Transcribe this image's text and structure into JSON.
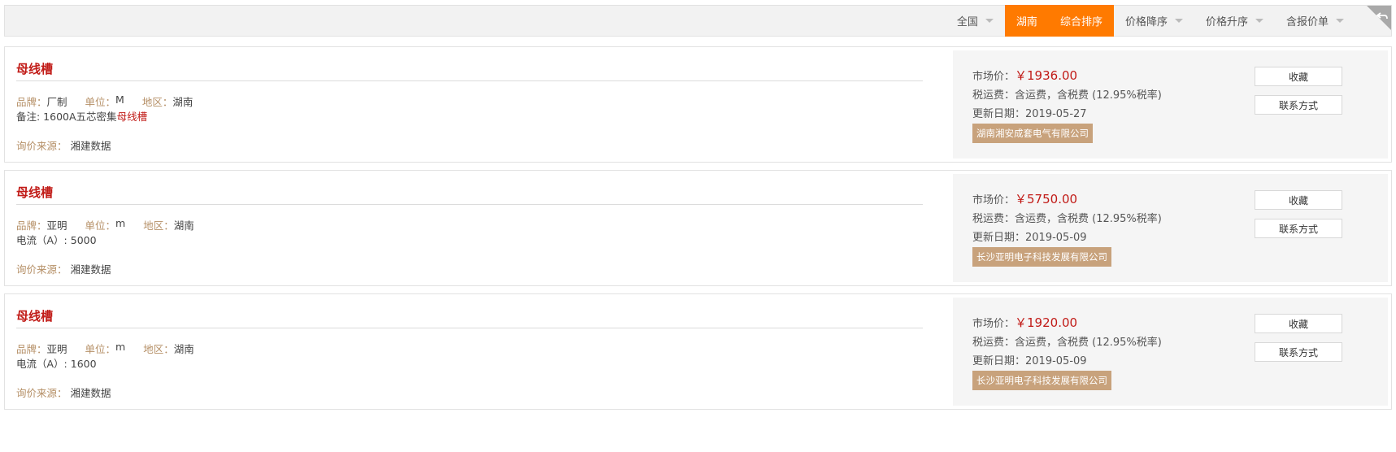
{
  "filters": {
    "items": [
      {
        "label": "全国",
        "caret": true,
        "active": false
      },
      {
        "label": "湖南",
        "caret": false,
        "active": true
      },
      {
        "label": "综合排序",
        "caret": false,
        "active": true
      },
      {
        "label": "价格降序",
        "caret": true,
        "active": false
      },
      {
        "label": "价格升序",
        "caret": true,
        "active": false
      },
      {
        "label": "含报价单",
        "caret": true,
        "active": false
      }
    ],
    "accent_color": "#ff7a00"
  },
  "labels": {
    "brand": "品牌：",
    "unit": "单位：",
    "region": "地区：",
    "source": "询价来源：",
    "market_price": "市场价：",
    "shipping_tax": "税运费：",
    "updated": "更新日期：",
    "favorite_button": "收藏",
    "contact_button": "联系方式"
  },
  "products": [
    {
      "name": "母线槽",
      "brand": "厂制",
      "unit": "M",
      "region": "湖南",
      "note_prefix": "备注: 1600A五芯密集",
      "note_highlight": "母线槽",
      "source": "湘建数据",
      "price": "￥1936.00",
      "shipping_tax": "含运费，含税费 (12.95%税率)",
      "updated": "2019-05-27",
      "supplier": "湖南湘安成套电气有限公司"
    },
    {
      "name": "母线槽",
      "brand": "亚明",
      "unit": "m",
      "region": "湖南",
      "note_prefix": "电流（A）: 5000",
      "note_highlight": "",
      "source": "湘建数据",
      "price": "￥5750.00",
      "shipping_tax": "含运费，含税费 (12.95%税率)",
      "updated": "2019-05-09",
      "supplier": "长沙亚明电子科技发展有限公司"
    },
    {
      "name": "母线槽",
      "brand": "亚明",
      "unit": "m",
      "region": "湖南",
      "note_prefix": "电流（A）: 1600",
      "note_highlight": "",
      "source": "湘建数据",
      "price": "￥1920.00",
      "shipping_tax": "含运费，含税费 (12.95%税率)",
      "updated": "2019-05-09",
      "supplier": "长沙亚明电子科技发展有限公司"
    }
  ],
  "colors": {
    "title_red": "#c11b17",
    "label_tan": "#b58f66",
    "supplier_badge": "#c8a27c"
  },
  "icons": {
    "corner": "back-arrow-icon"
  }
}
